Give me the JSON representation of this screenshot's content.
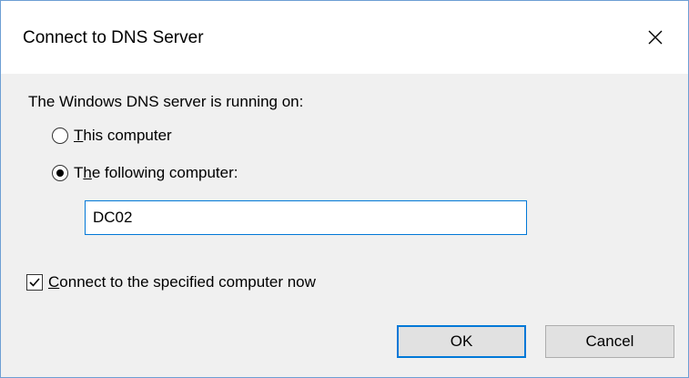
{
  "dialog": {
    "title": "Connect to DNS Server",
    "prompt": "The Windows DNS server is running on:",
    "options": [
      {
        "accel": "T",
        "rest": "his computer",
        "selected": false
      },
      {
        "accel_prefix": "T",
        "accel": "h",
        "rest": "e following computer:",
        "selected": true
      }
    ],
    "computer_name": "DC02",
    "connect_now": {
      "accel": "C",
      "rest": "onnect to the specified computer now",
      "checked": true
    },
    "ok_label": "OK",
    "cancel_label": "Cancel"
  },
  "icons": {
    "close": "close-icon",
    "checkmark": "checkmark-icon"
  },
  "colors": {
    "accent": "#0078d7",
    "window_border": "#6d9fd4",
    "dialog_bg": "#f0f0f0",
    "button_bg": "#e1e1e1"
  }
}
